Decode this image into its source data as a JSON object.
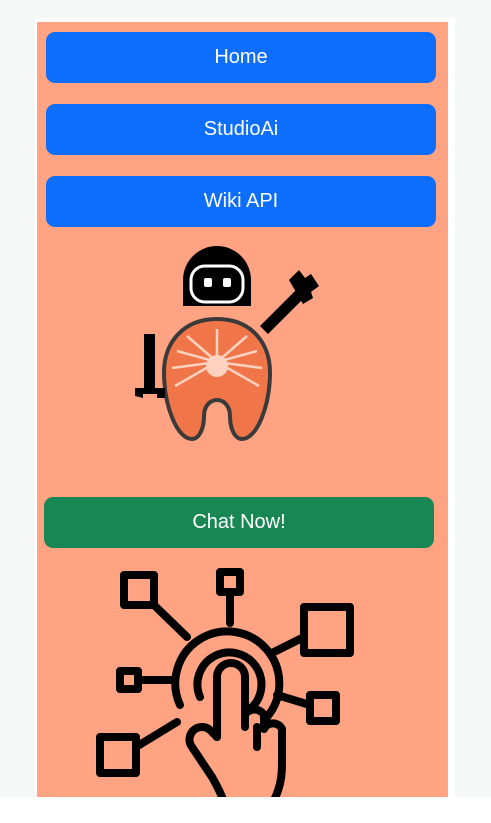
{
  "nav": {
    "items": [
      {
        "label": "Home"
      },
      {
        "label": "StudioAi"
      },
      {
        "label": "Wiki API"
      }
    ]
  },
  "cta": {
    "label": "Chat Now!"
  },
  "colors": {
    "page_bg": "#f6f8f7",
    "panel_bg": "#ffa382",
    "nav_button": "#0d6efd",
    "chat_button": "#198754",
    "salmon_icon": "#f0764a"
  },
  "icons": {
    "robot": "salmon-robot-icon",
    "network": "touch-network-icon"
  }
}
